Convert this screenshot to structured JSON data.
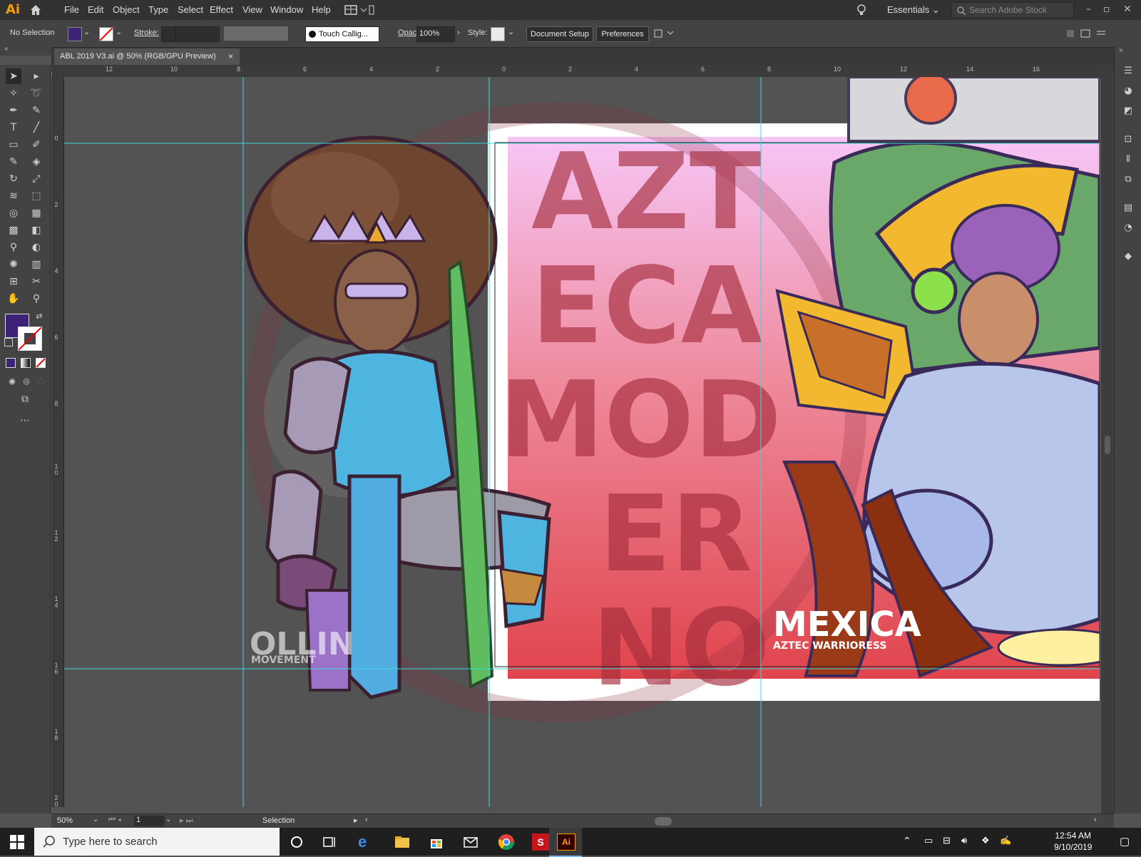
{
  "app": {
    "logo": "Ai",
    "menu": [
      "File",
      "Edit",
      "Object",
      "Type",
      "Select",
      "Effect",
      "View",
      "Window",
      "Help"
    ],
    "workspace": "Essentials",
    "search_placeholder": "Search Adobe Stock"
  },
  "control": {
    "selection": "No Selection",
    "stroke_label": "Stroke:",
    "brush": "Touch Callig...",
    "opacity_label": "Opacity:",
    "opacity_value": "100%",
    "style_label": "Style:",
    "document_setup": "Document Setup",
    "preferences": "Preferences",
    "fill_color": "#3d2275"
  },
  "tab": {
    "title": "ABL 2019 V3.ai @ 50% (RGB/GPU Preview)",
    "close": "×"
  },
  "ruler": {
    "h": [
      "12",
      "10",
      "8",
      "6",
      "4",
      "2",
      "0",
      "2",
      "4",
      "6",
      "8",
      "10",
      "12",
      "14",
      "16"
    ],
    "v": [
      "0",
      "2",
      "4",
      "6",
      "8",
      "1\n0",
      "1\n2",
      "1\n4",
      "1\n6",
      "1\n8",
      "2\n0"
    ]
  },
  "artwork": {
    "big_letters": [
      "AZT",
      "ECA",
      "MOD",
      "ER",
      "NO"
    ],
    "left_title": "OLLIN",
    "left_sub": "MOVEMENT",
    "right_title": "MEXICA",
    "right_sub": "AZTEC WARRIORESS"
  },
  "status": {
    "zoom": "50%",
    "page": "1",
    "tool": "Selection"
  },
  "taskbar": {
    "search_placeholder": "Type here to search",
    "time": "12:54 AM",
    "date": "9/10/2019"
  },
  "colors": {
    "accent": "#ff9a00",
    "guide": "#3ad8e0",
    "poster_pink_top": "#f6c4f4",
    "poster_red_bottom": "#e0444c"
  }
}
